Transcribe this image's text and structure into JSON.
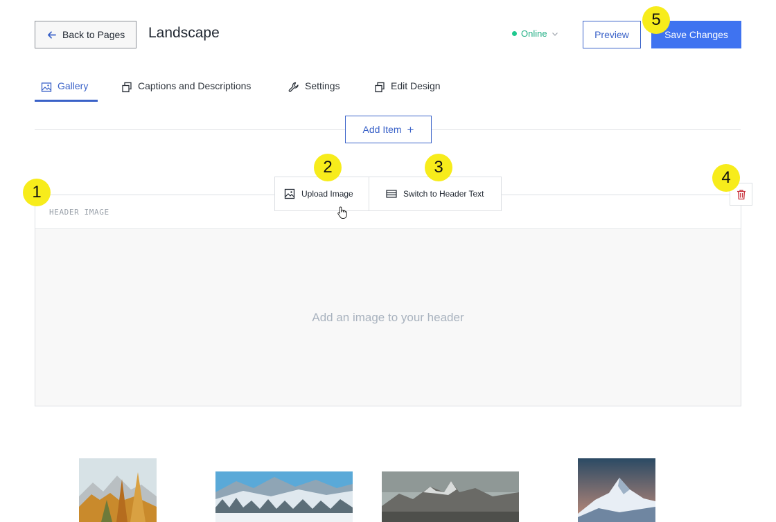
{
  "header": {
    "back_label": "Back to Pages",
    "title": "Landscape",
    "status_label": "Online",
    "preview_label": "Preview",
    "save_label": "Save Changes"
  },
  "tabs": [
    {
      "label": "Gallery",
      "icon": "image-icon",
      "active": true
    },
    {
      "label": "Captions and Descriptions",
      "icon": "layers-icon",
      "active": false
    },
    {
      "label": "Settings",
      "icon": "wrench-icon",
      "active": false
    },
    {
      "label": "Edit Design",
      "icon": "layers-icon",
      "active": false
    }
  ],
  "add_item": {
    "label": "Add Item",
    "icon": "plus-icon"
  },
  "header_section": {
    "label": "HEADER IMAGE",
    "empty_text": "Add an image to your header",
    "toolbar": {
      "upload_label": "Upload Image",
      "switch_label": "Switch to Header Text"
    },
    "delete_icon": "trash-icon"
  },
  "badges": [
    "1",
    "2",
    "3",
    "4",
    "5"
  ],
  "thumbnails": [
    "autumn-forest-mountain",
    "snowy-forest-mountains",
    "rocky-mountain-range",
    "snow-peak-night"
  ],
  "colors": {
    "accent": "#3a62c8",
    "primary_button": "#3f73f0",
    "online": "#1fc98f",
    "badge": "#f7ec1b",
    "delete": "#c8323c"
  }
}
